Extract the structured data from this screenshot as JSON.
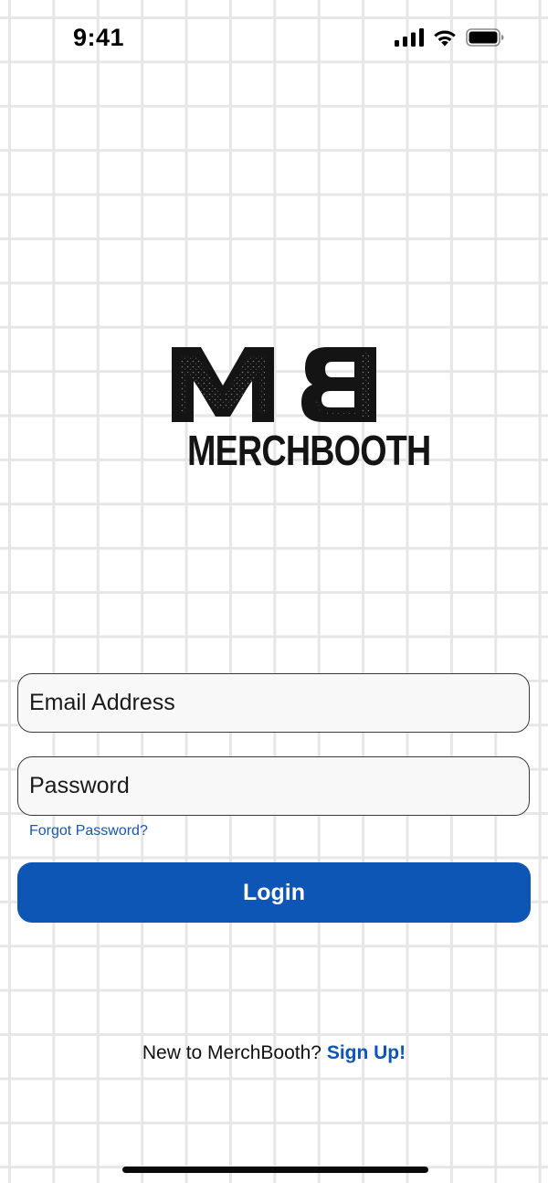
{
  "status_bar": {
    "time": "9:41",
    "icons": [
      "cellular-signal-icon",
      "wifi-icon",
      "battery-icon"
    ]
  },
  "logo": {
    "monogram": "MB",
    "wordmark": "MERCHBOOTH"
  },
  "login_form": {
    "email_placeholder": "Email Address",
    "email_value": "",
    "password_placeholder": "Password",
    "password_value": "",
    "forgot_password_label": "Forgot Password?",
    "login_label": "Login"
  },
  "signup": {
    "prompt": "New to MerchBooth?",
    "link_label": "Sign Up!"
  },
  "colors": {
    "accent": "#0d56b5",
    "link": "#1557b7",
    "grid_line": "#e6e6e6",
    "field_background": "#f8f8f8"
  }
}
